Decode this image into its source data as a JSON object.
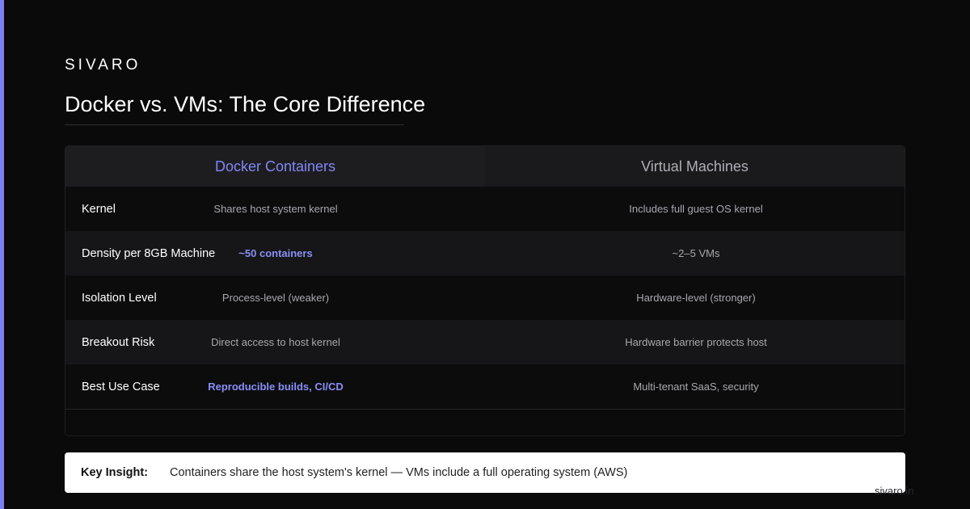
{
  "brand": "SIVARO",
  "title": "Docker vs. VMs: The Core Difference",
  "colors": {
    "accent": "#7b7ff0",
    "docker_header": "#8287f5",
    "background": "#0a0a0b"
  },
  "table": {
    "headers": [
      "Docker Containers",
      "Virtual Machines"
    ],
    "rows": [
      {
        "label": "Kernel",
        "docker": "Shares host system kernel",
        "vm": "Includes full guest OS kernel",
        "docker_highlight": false
      },
      {
        "label": "Density per 8GB Machine",
        "docker": "~50 containers",
        "vm": "~2–5 VMs",
        "docker_highlight": true
      },
      {
        "label": "Isolation Level",
        "docker": "Process-level (weaker)",
        "vm": "Hardware-level (stronger)",
        "docker_highlight": false
      },
      {
        "label": "Breakout Risk",
        "docker": "Direct access to host kernel",
        "vm": "Hardware barrier protects host",
        "docker_highlight": false
      },
      {
        "label": "Best Use Case",
        "docker": "Reproducible builds, CI/CD",
        "vm": "Multi-tenant SaaS, security",
        "docker_highlight": true
      }
    ]
  },
  "insight": {
    "label": "Key Insight:",
    "text": "Containers share the host system's kernel — VMs include a full operating system (AWS)"
  },
  "watermark": "sivaro.in"
}
